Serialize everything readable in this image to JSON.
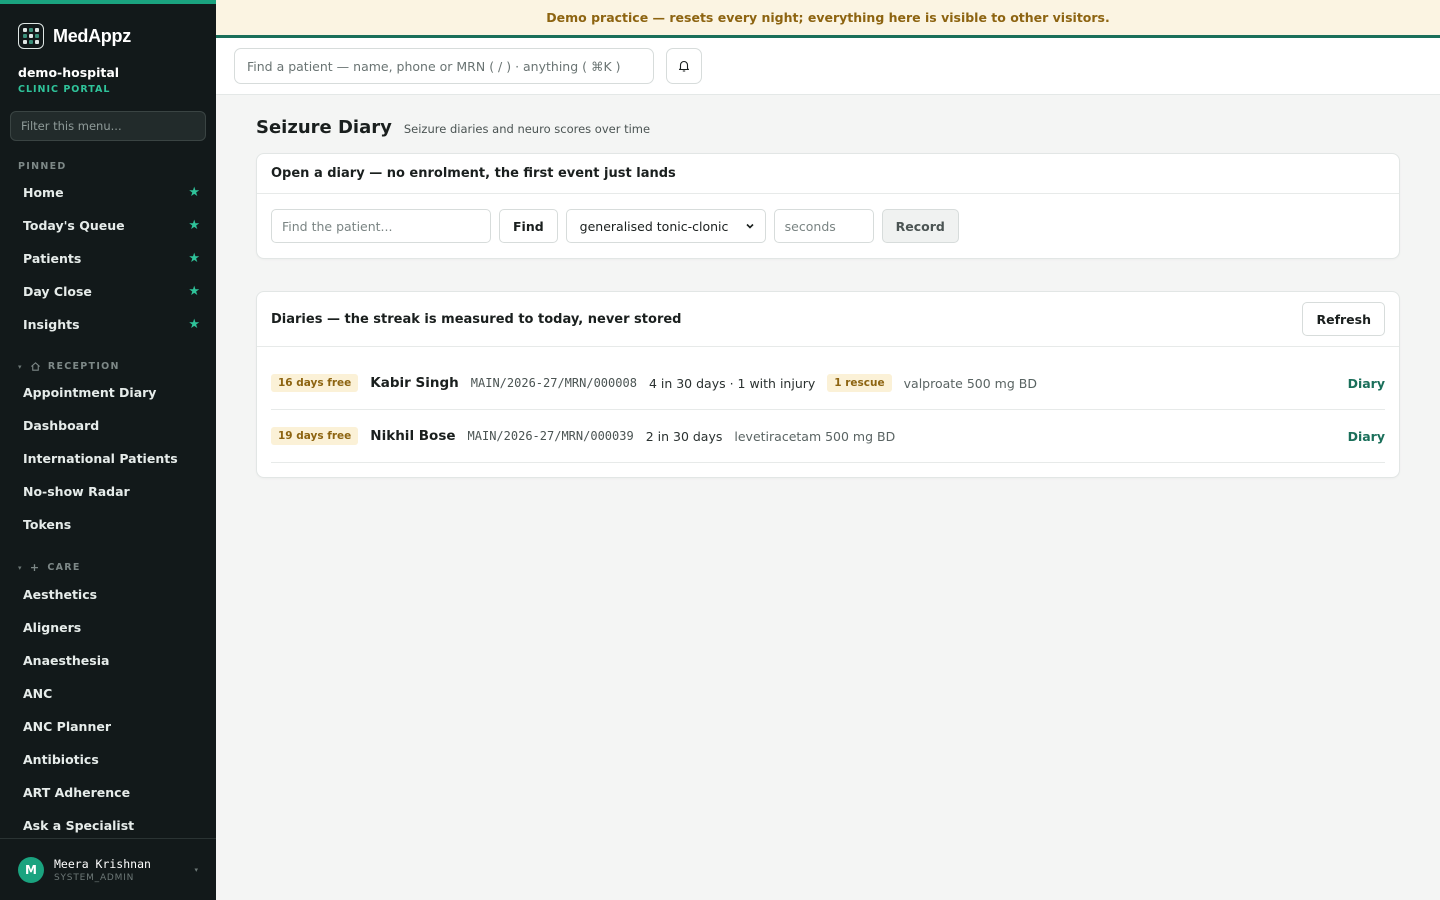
{
  "brand": {
    "name": "MedAppz"
  },
  "tenant": {
    "name": "demo-hospital",
    "subtitle": "CLINIC PORTAL"
  },
  "sidebar": {
    "filter_placeholder": "Filter this menu...",
    "pinned_label": "PINNED",
    "pinned": [
      {
        "label": "Home"
      },
      {
        "label": "Today's Queue"
      },
      {
        "label": "Patients"
      },
      {
        "label": "Day Close"
      },
      {
        "label": "Insights"
      }
    ],
    "reception_label": "RECEPTION",
    "reception": [
      {
        "label": "Appointment Diary"
      },
      {
        "label": "Dashboard"
      },
      {
        "label": "International Patients"
      },
      {
        "label": "No-show Radar"
      },
      {
        "label": "Tokens"
      }
    ],
    "care_label": "CARE",
    "care": [
      {
        "label": "Aesthetics"
      },
      {
        "label": "Aligners"
      },
      {
        "label": "Anaesthesia"
      },
      {
        "label": "ANC"
      },
      {
        "label": "ANC Planner"
      },
      {
        "label": "Antibiotics"
      },
      {
        "label": "ART Adherence"
      },
      {
        "label": "Ask a Specialist"
      }
    ]
  },
  "user": {
    "initial": "M",
    "name": "Meera Krishnan",
    "role": "SYSTEM_ADMIN"
  },
  "banner": {
    "text": "Demo practice — resets every night; everything here is visible to other visitors."
  },
  "topbar": {
    "search_placeholder": "Find a patient — name, phone or MRN ( / ) · anything ( ⌘K )"
  },
  "page": {
    "title": "Seizure Diary",
    "subtitle": "Seizure diaries and neuro scores over time"
  },
  "open_card": {
    "title": "Open a diary — no enrolment, the first event just lands",
    "patient_placeholder": "Find the patient...",
    "find_label": "Find",
    "seizure_type": "generalised tonic-clonic",
    "seconds_placeholder": "seconds",
    "record_label": "Record"
  },
  "diaries_card": {
    "title": "Diaries — the streak is measured to today, never stored",
    "refresh_label": "Refresh",
    "rows": [
      {
        "badge": "16 days free",
        "name": "Kabir Singh",
        "mrn": "MAIN/2026-27/MRN/000008",
        "events": "4 in 30 days · 1 with injury",
        "rescue": "1 rescue",
        "med": "valproate 500 mg BD",
        "link": "Diary"
      },
      {
        "badge": "19 days free",
        "name": "Nikhil Bose",
        "mrn": "MAIN/2026-27/MRN/000039",
        "events": "2 in 30 days",
        "med": "levetiracetam 500 mg BD",
        "link": "Diary"
      }
    ]
  },
  "colors": {
    "accent": "#1aa37f",
    "sidebar_bg": "#12191a",
    "banner_bg": "#fbf4e2",
    "banner_text": "#8d6411",
    "link": "#1a6f5a"
  },
  "icons": {
    "pin": "star-icon",
    "bell": "bell-icon",
    "reception": "home-icon",
    "care": "plus-icon"
  }
}
